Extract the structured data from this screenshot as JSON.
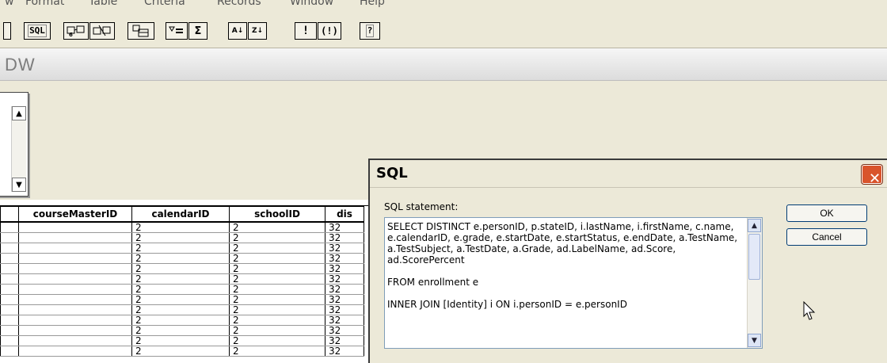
{
  "menu": [
    "w",
    "Format",
    "Table",
    "Criteria",
    "Records",
    "Window",
    "Help"
  ],
  "toolbar": {
    "sql_label": "SQL",
    "sort_asc": "A↓",
    "sort_desc": "Z↓",
    "help": "?"
  },
  "query_window": {
    "title": "DW"
  },
  "grid": {
    "columns": [
      "courseMasterID",
      "calendarID",
      "schoolID",
      "dis"
    ],
    "rows": [
      [
        "",
        "2",
        "2",
        "32"
      ],
      [
        "",
        "2",
        "2",
        "32"
      ],
      [
        "",
        "2",
        "2",
        "32"
      ],
      [
        "",
        "2",
        "2",
        "32"
      ],
      [
        "",
        "2",
        "2",
        "32"
      ],
      [
        "",
        "2",
        "2",
        "32"
      ],
      [
        "",
        "2",
        "2",
        "32"
      ],
      [
        "",
        "2",
        "2",
        "32"
      ],
      [
        "",
        "2",
        "2",
        "32"
      ],
      [
        "",
        "2",
        "2",
        "32"
      ],
      [
        "",
        "2",
        "2",
        "32"
      ],
      [
        "",
        "2",
        "2",
        "32"
      ],
      [
        "",
        "2",
        "2",
        "32"
      ]
    ]
  },
  "sql_dialog": {
    "title": "SQL",
    "label": "SQL statement:",
    "statement": "SELECT DISTINCT e.personID, p.stateID, i.lastName, i.firstName, c.name, e.calendarID, e.grade, e.startDate, e.startStatus, e.endDate, a.TestName, a.TestSubject, a.TestDate, a.Grade, ad.LabelName, ad.Score, ad.ScorePercent\n\nFROM enrollment e\n\nINNER JOIN [Identity] i ON i.personID = e.personID",
    "ok_label": "OK",
    "cancel_label": "Cancel",
    "close_symbol": "✕"
  }
}
